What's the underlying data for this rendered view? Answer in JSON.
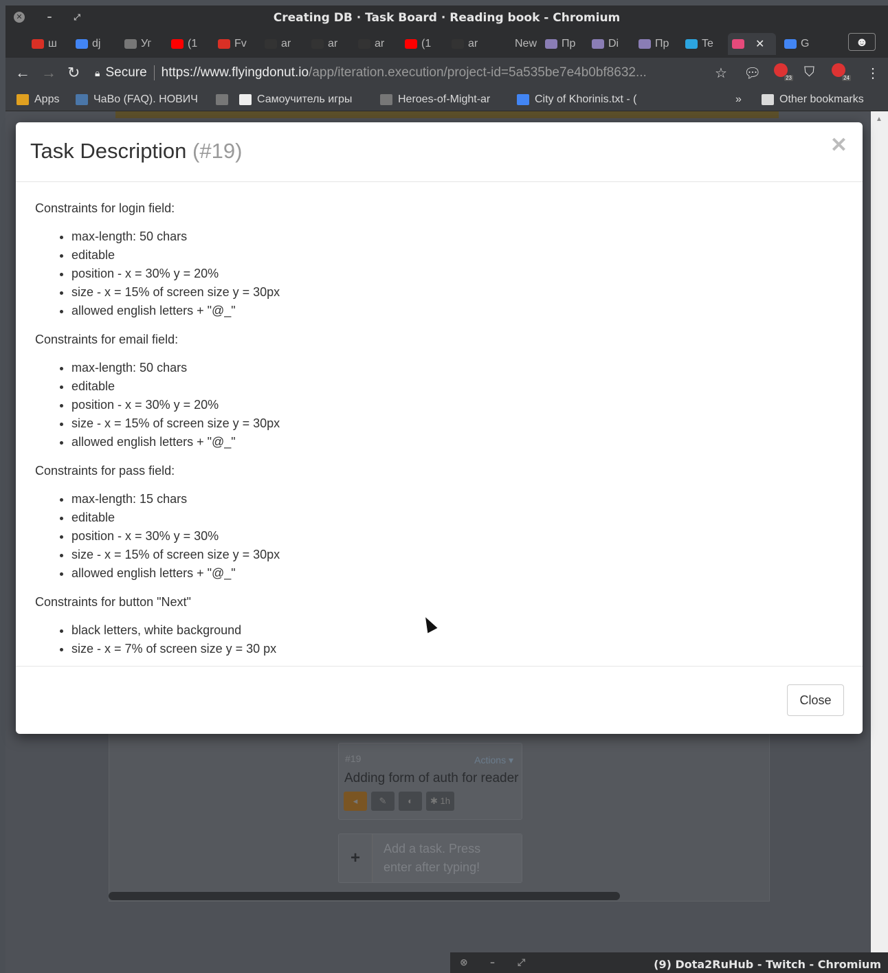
{
  "window": {
    "title": "Creating DB · Task Board · Reading book - Chromium"
  },
  "tabs": [
    {
      "label": "ш",
      "color": "#d93025"
    },
    {
      "label": "dj",
      "color": "#4285f4"
    },
    {
      "label": "Уг",
      "color": "#777777"
    },
    {
      "label": "(1",
      "color": "#ff0000"
    },
    {
      "label": "Fv",
      "color": "#d93025"
    },
    {
      "label": "ar",
      "color": "#333333"
    },
    {
      "label": "ar",
      "color": "#333333"
    },
    {
      "label": "ar",
      "color": "#333333"
    },
    {
      "label": "(1",
      "color": "#ff0000"
    },
    {
      "label": "ar",
      "color": "#333333"
    },
    {
      "label": "New T",
      "color": "#2d2e30"
    },
    {
      "label": "Пр",
      "color": "#8a7db5"
    },
    {
      "label": "Di",
      "color": "#8a7db5"
    },
    {
      "label": "Пр",
      "color": "#8a7db5"
    },
    {
      "label": "Te",
      "color": "#2ca5e0"
    },
    {
      "label": "",
      "color": "#e64a7b",
      "active": true
    },
    {
      "label": "G",
      "color": "#4285f4"
    }
  ],
  "toolbar": {
    "secure_label": "Secure",
    "url_host": "https://www.flyingdonut.io",
    "url_path": "/app/iteration.execution/project-id=5a535be7e4b0bf8632...",
    "ext_badge_1": "23",
    "ext_badge_2": "24"
  },
  "bookmarks": [
    {
      "label": "Apps",
      "color": "#e0a020"
    },
    {
      "label": "ЧаВо (FAQ). НОВИЧ",
      "color": "#4a76a8"
    },
    {
      "label": "",
      "color": "#777777"
    },
    {
      "label": "Самоучитель игры",
      "color": "#eeeeee"
    },
    {
      "label": "Heroes-of-Might-ar",
      "color": "#777777"
    },
    {
      "label": "City of Khorinis.txt - (",
      "color": "#4285f4"
    }
  ],
  "bookmarks_more": "»",
  "other_bookmarks": "Other bookmarks",
  "board": {
    "card": {
      "number": "#19",
      "actions": "Actions ▾",
      "title": "Adding form of auth for reader",
      "estimate": "✱ 1h"
    },
    "add_task_placeholder": "Add a task. Press enter after typing!"
  },
  "modal": {
    "title": "Task Description",
    "task_id": "(#19)",
    "sections": [
      {
        "heading": "Constraints for login field:",
        "items": [
          "max-length: 50 chars",
          "editable",
          "position - x = 30% y = 20%",
          "size - x = 15% of screen size y = 30px",
          "allowed english letters + \"@_\""
        ]
      },
      {
        "heading": "Constraints for email field:",
        "items": [
          "max-length: 50 chars",
          "editable",
          "position - x = 30% y = 20%",
          "size - x = 15% of screen size y = 30px",
          "allowed english letters + \"@_\""
        ]
      },
      {
        "heading": "Constraints for pass field:",
        "items": [
          "max-length: 15 chars",
          "editable",
          "position - x = 30% y = 30%",
          "size - x = 15% of screen size y = 30px",
          "allowed english letters + \"@_\""
        ]
      },
      {
        "heading": "Constraints for button \"Next\"",
        "items": [
          "black letters, white background",
          "size - x = 7% of screen size y = 30 px"
        ]
      }
    ],
    "close_label": "Close"
  },
  "second_window": {
    "title": "(9) Dota2RuHub - Twitch - Chromium"
  }
}
